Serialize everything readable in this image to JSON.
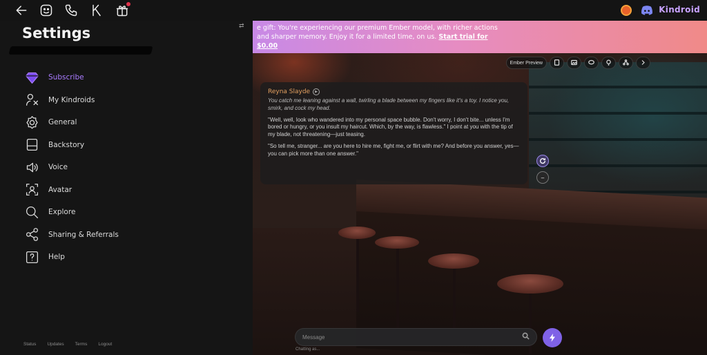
{
  "topbar": {
    "icons": [
      "back-arrow-icon",
      "emoji-icon",
      "phone-icon",
      "k-logo-icon",
      "gift-icon"
    ],
    "brand": "Kindroid",
    "right_icons": [
      "avatar-icon",
      "discord-icon"
    ]
  },
  "sidebar": {
    "title": "Settings",
    "items": [
      {
        "label": "Subscribe",
        "icon": "diamond-icon",
        "active": true
      },
      {
        "label": "My Kindroids",
        "icon": "people-icon"
      },
      {
        "label": "General",
        "icon": "gear-icon"
      },
      {
        "label": "Backstory",
        "icon": "book-icon"
      },
      {
        "label": "Voice",
        "icon": "speaker-icon"
      },
      {
        "label": "Avatar",
        "icon": "avatar-icon"
      },
      {
        "label": "Explore",
        "icon": "search-icon"
      },
      {
        "label": "Sharing & Referrals",
        "icon": "share-icon"
      },
      {
        "label": "Help",
        "icon": "help-icon"
      }
    ],
    "footer": [
      "Status",
      "Updates",
      "Terms",
      "Logout"
    ]
  },
  "chat": {
    "banner": {
      "text": "e gift: You're experiencing our premium Ember model, with richer actions and sharper memory. Enjoy it for a limited time, on us.",
      "start_link": "Start trial for $0.00"
    },
    "toolbar": {
      "model_label": "Ember Preview"
    },
    "message": {
      "name": "Reyna Slayde",
      "paragraphs": [
        "You catch me leaning against a wall, twirling a blade between my fingers like it's a toy. I notice you, smirk, and cock my head.",
        "\"Well, well, look who wandered into my personal space bubble. Don't worry, I don't bite... unless I'm bored or hungry, or you insult my haircut. Which, by the way, is flawless.\" I point at you with the tip of my blade, not threatening—just teasing.",
        "\"So tell me, stranger... are you here to hire me, fight me, or flirt with me? And before you answer, yes—you can pick more than one answer.\""
      ]
    },
    "input": {
      "placeholder": "Message",
      "note": "Chatting as..."
    }
  }
}
